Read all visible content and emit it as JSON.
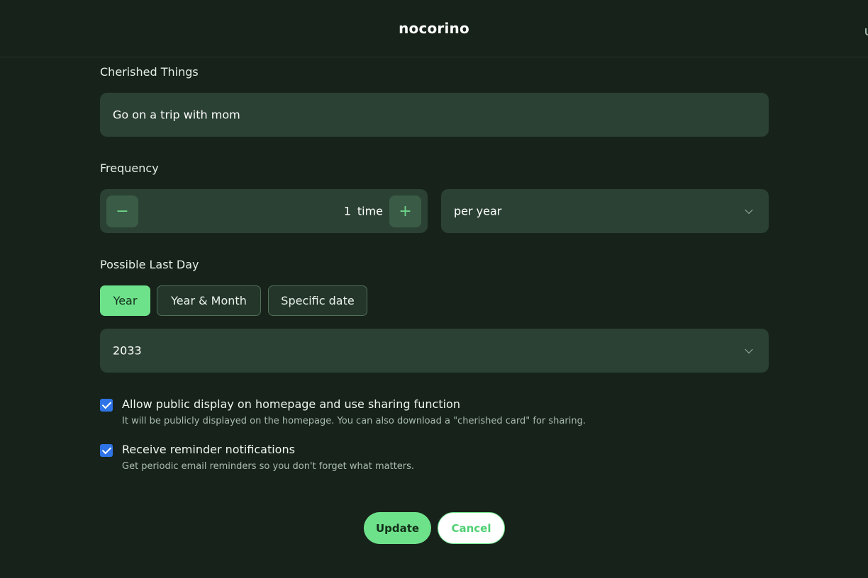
{
  "header": {
    "app_title": "nocorino"
  },
  "cherished": {
    "label": "Cherished Things",
    "value": "Go on a trip with mom"
  },
  "frequency": {
    "label": "Frequency",
    "count": "1",
    "unit": "time",
    "minus_symbol": "−",
    "plus_symbol": "+",
    "period": "per year"
  },
  "last_day": {
    "label": "Possible Last Day",
    "options": [
      "Year",
      "Year & Month",
      "Specific date"
    ],
    "selected": "Year",
    "year_value": "2033"
  },
  "public_display": {
    "checked": true,
    "label": "Allow public display on homepage and use sharing function",
    "help": "It will be publicly displayed on the homepage. You can also download a \"cherished card\" for sharing."
  },
  "reminders": {
    "checked": true,
    "label": "Receive reminder notifications",
    "help": "Get periodic email reminders so you don't forget what matters."
  },
  "actions": {
    "update": "Update",
    "cancel": "Cancel"
  },
  "colors": {
    "accent": "#6ee28a",
    "background": "#17231a",
    "field": "#2b4134",
    "checkbox": "#2e74e6"
  }
}
